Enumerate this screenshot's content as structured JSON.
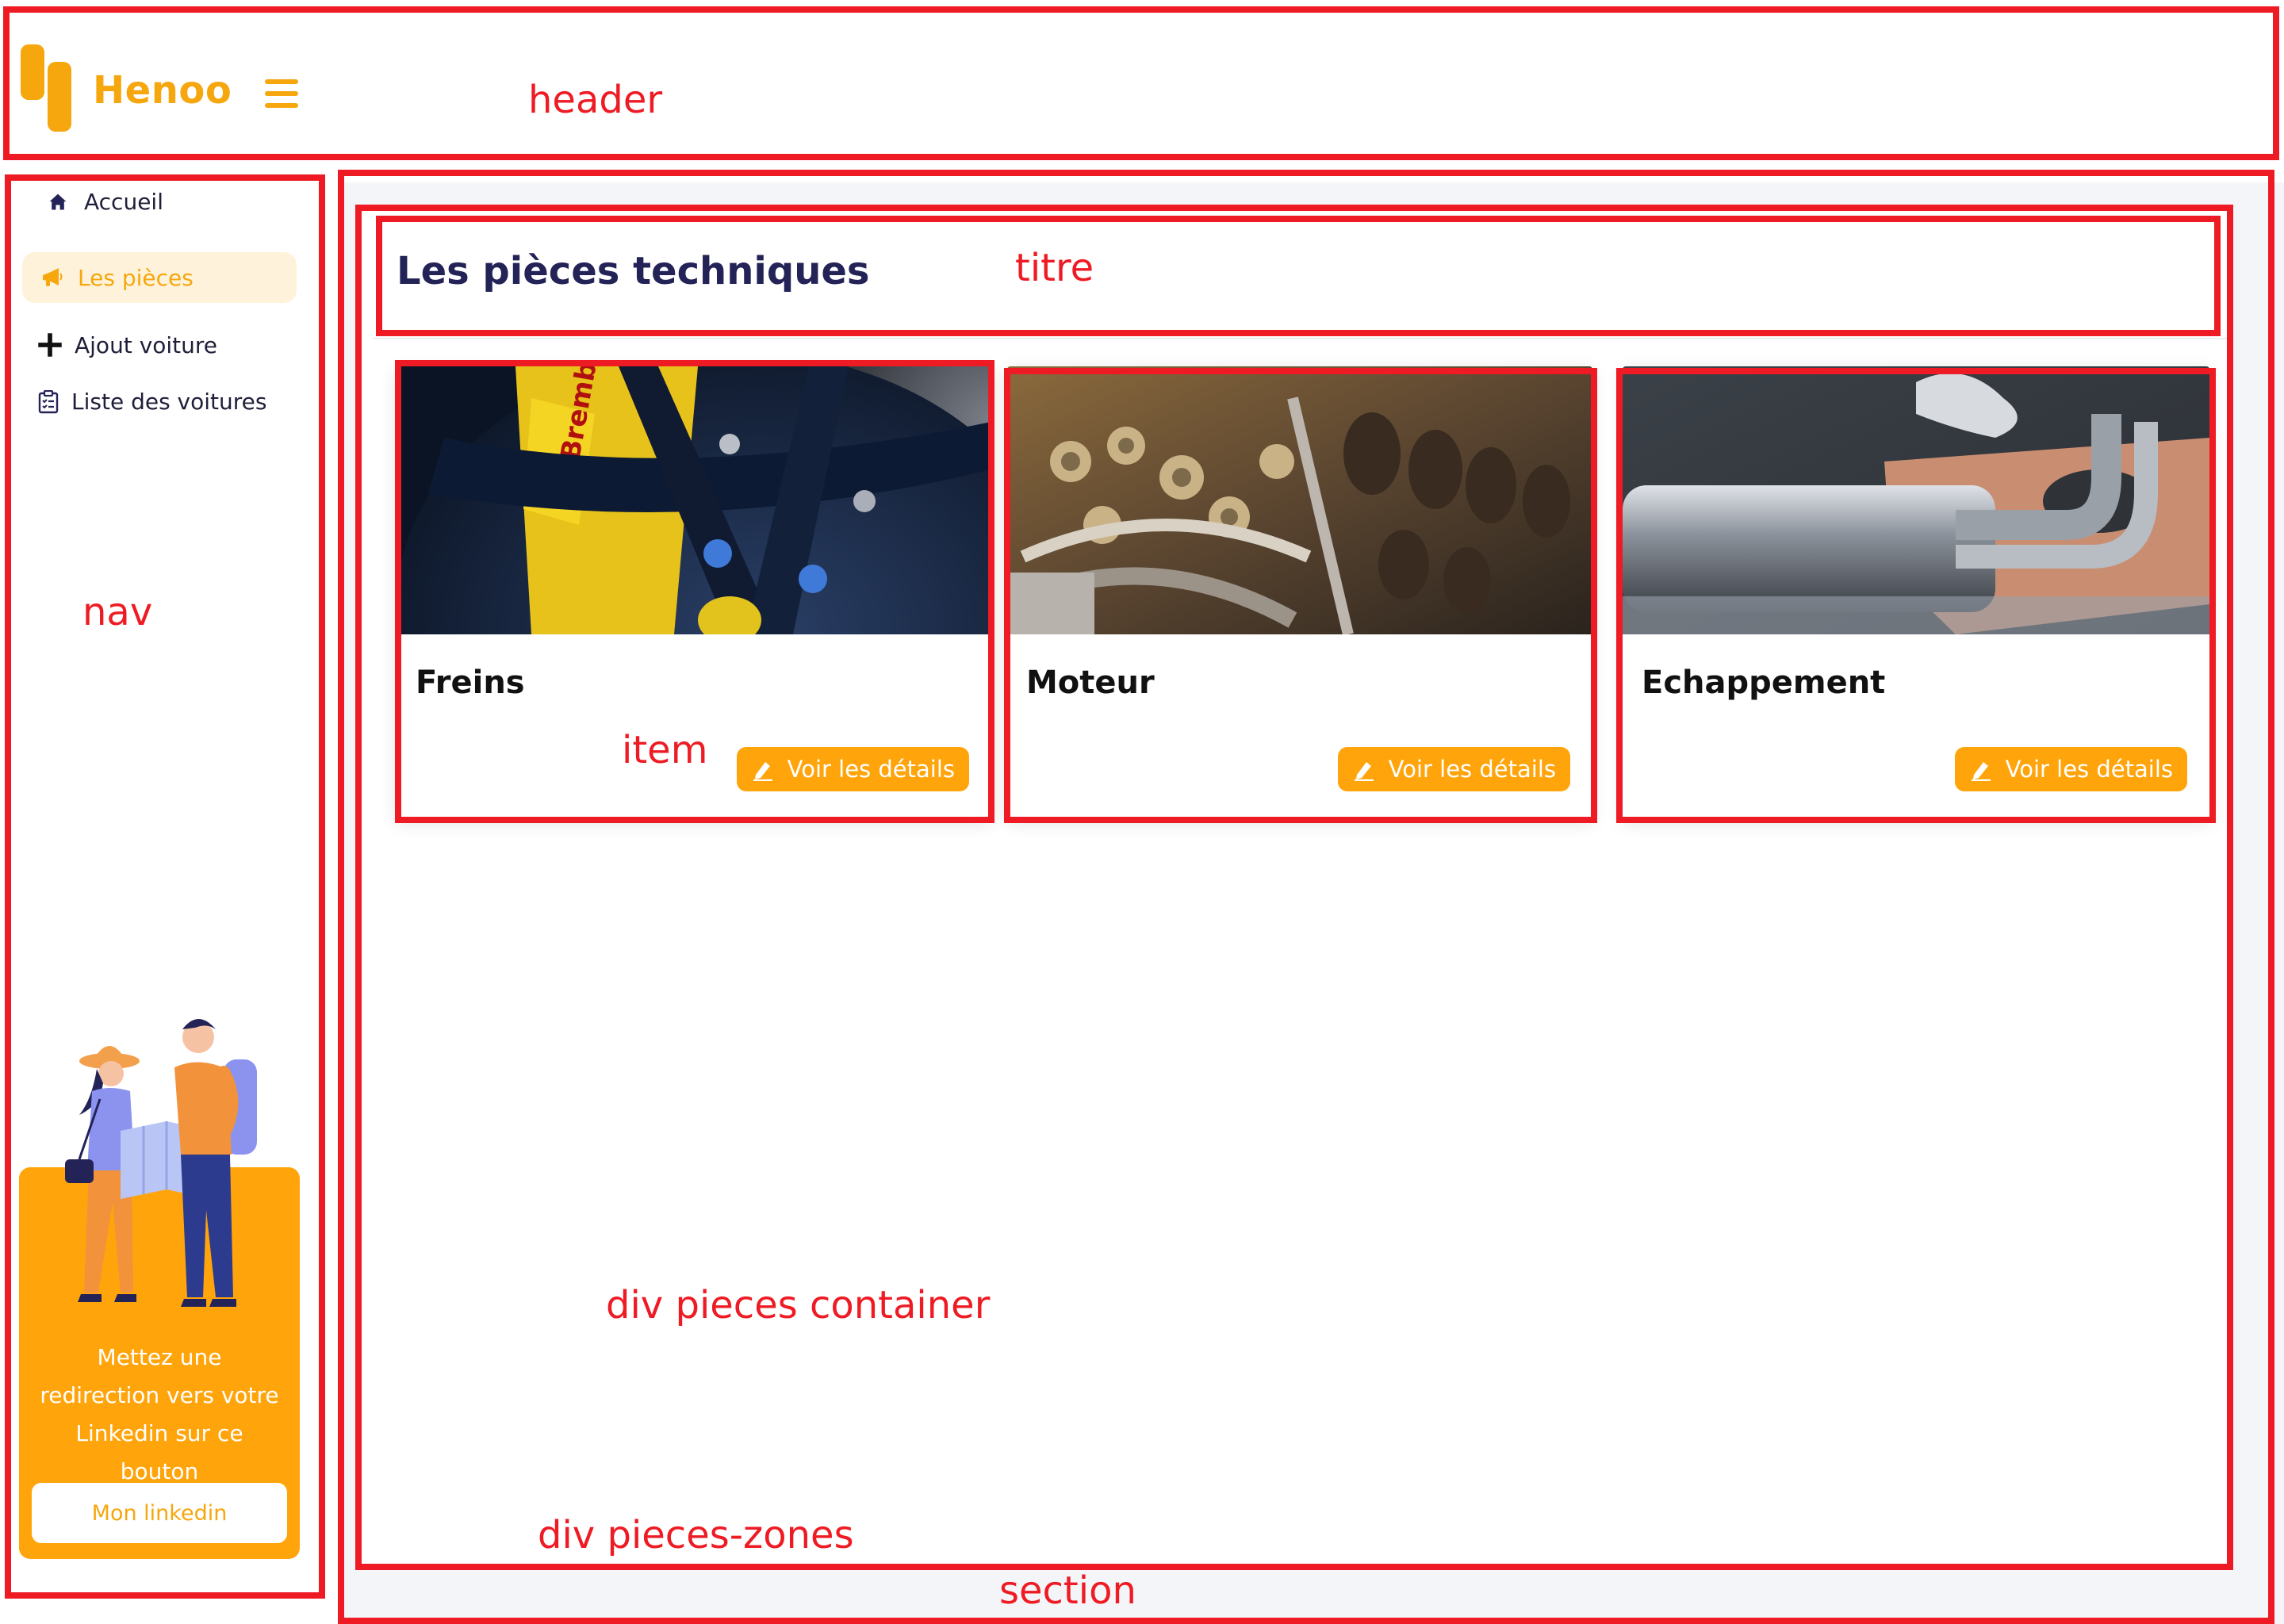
{
  "app": {
    "brand": "Henoo",
    "accent": "#ffa40a",
    "text_dark": "#232357"
  },
  "header": {
    "menu_icon": "hamburger-icon",
    "logo_icon": "henoo-logo-icon"
  },
  "nav": {
    "items": [
      {
        "label": "Accueil",
        "icon": "home-icon",
        "active": false
      },
      {
        "label": "Les pièces",
        "icon": "megaphone-icon",
        "active": true
      },
      {
        "label": "Ajout voiture",
        "icon": "plus-icon",
        "active": false
      },
      {
        "label": "Liste des voitures",
        "icon": "checklist-icon",
        "active": false
      }
    ]
  },
  "promo": {
    "text": "Mettez une redirection vers votre Linkedin sur ce bouton",
    "button_label": "Mon linkedin"
  },
  "main": {
    "title": "Les pièces techniques",
    "cards": [
      {
        "name": "Freins",
        "button_label": "Voir les détails",
        "image": "brake-caliper-photo"
      },
      {
        "name": "Moteur",
        "button_label": "Voir les détails",
        "image": "engine-photo"
      },
      {
        "name": "Echappement",
        "button_label": "Voir les détails",
        "image": "exhaust-pipe-photo"
      }
    ]
  },
  "annotations": {
    "header": "header",
    "nav": "nav",
    "titre": "titre",
    "item": "item",
    "pieces_container": "div pieces container",
    "pieces_zones": "div pieces-zones",
    "section": "section"
  }
}
